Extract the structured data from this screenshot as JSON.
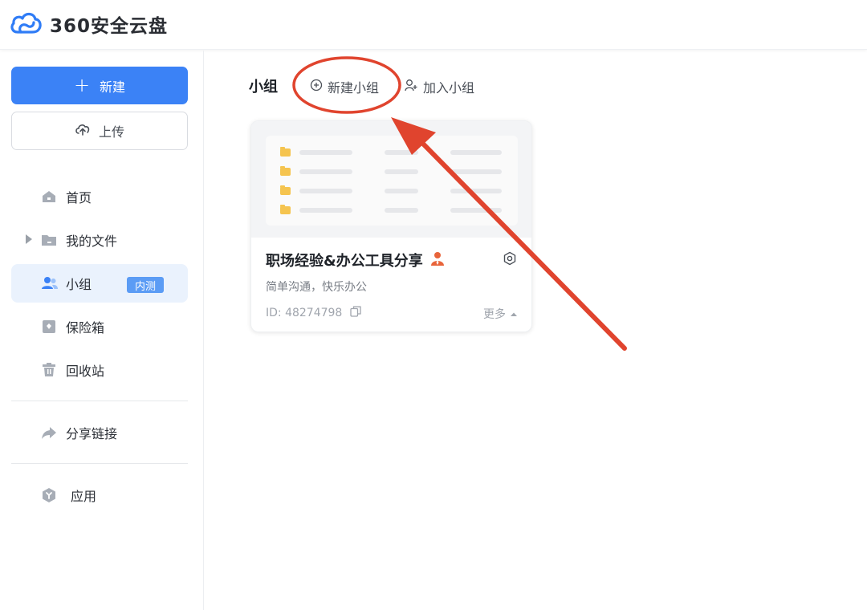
{
  "app": {
    "logo_text": "360安全云盘"
  },
  "sidebar": {
    "new_label": "新建",
    "upload_label": "上传",
    "items": [
      {
        "label": "首页"
      },
      {
        "label": "我的文件"
      },
      {
        "label": "小组",
        "badge": "内测"
      },
      {
        "label": "保险箱"
      },
      {
        "label": "回收站"
      },
      {
        "label": "分享链接"
      },
      {
        "label": "应用"
      }
    ]
  },
  "main": {
    "title": "小组",
    "create_group_label": "新建小组",
    "join_group_label": "加入小组",
    "card": {
      "title": "职场经验&办公工具分享",
      "description": "简单沟通，快乐办公",
      "id_text": "ID: 48274798",
      "more_label": "更多"
    }
  },
  "colors": {
    "accent": "#3b82f6",
    "active_bg": "#eaf2fd",
    "badge": "#5b9cf5",
    "annotation_red": "#e0442e",
    "owner_icon": "#e8643a"
  },
  "icons": {
    "logo": "cloud-icon",
    "new": "plus-icon",
    "upload": "upload-cloud-icon",
    "home": "home-icon",
    "files": "folder-icon",
    "group": "users-icon",
    "vault": "safe-icon",
    "trash": "trash-icon",
    "share": "share-arrow-icon",
    "apps": "app-hexagon-icon",
    "create": "plus-circle-icon",
    "join": "user-add-icon",
    "owner": "person-icon",
    "settings": "gear-icon",
    "copy": "copy-icon"
  }
}
